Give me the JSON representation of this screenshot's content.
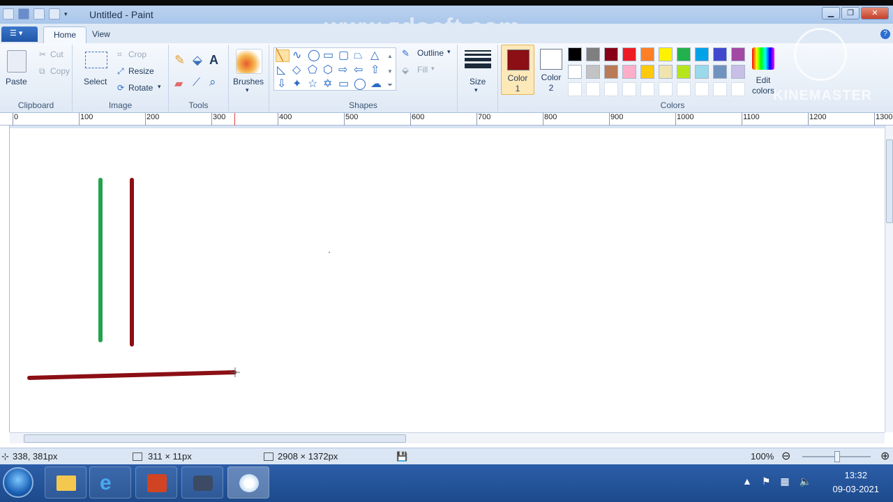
{
  "window": {
    "title": "Untitled - Paint",
    "watermark": "www.zdsoft.com",
    "kinemaster": "KINEMASTER"
  },
  "tabs": [
    {
      "label": "Home",
      "active": true
    },
    {
      "label": "View",
      "active": false
    }
  ],
  "clipboard": {
    "paste": "Paste",
    "cut": "Cut",
    "copy": "Copy",
    "group": "Clipboard"
  },
  "image": {
    "select": "Select",
    "crop": "Crop",
    "resize": "Resize",
    "rotate": "Rotate",
    "group": "Image"
  },
  "tools": {
    "group": "Tools"
  },
  "brushes": {
    "label": "Brushes"
  },
  "shapes": {
    "outline": "Outline",
    "fill": "Fill",
    "group": "Shapes"
  },
  "size": {
    "label": "Size"
  },
  "colors": {
    "color1_label": "Color",
    "color1_num": "1",
    "color2_label": "Color",
    "color2_num": "2",
    "color1_value": "#8b0f14",
    "color2_value": "#ffffff",
    "edit_colors": "Edit colors",
    "group": "Colors",
    "palette": [
      "#000000",
      "#7f7f7f",
      "#880015",
      "#ed1c24",
      "#ff7f27",
      "#fff200",
      "#22b14c",
      "#00a2e8",
      "#3f48cc",
      "#a349a4",
      "#ffffff",
      "#c3c3c3",
      "#b97a57",
      "#ffaec9",
      "#ffc90e",
      "#efe4b0",
      "#b5e61d",
      "#99d9ea",
      "#7092be",
      "#c8bfe7"
    ]
  },
  "ruler": {
    "ticks": [
      "0",
      "100",
      "200",
      "300",
      "400",
      "500",
      "600",
      "700",
      "800",
      "900",
      "1000",
      "1100",
      "1200",
      "1300"
    ]
  },
  "drawing": {
    "green_line_color": "#22a24c",
    "red_line_color": "#8b0f14"
  },
  "status": {
    "cursor": "338, 381px",
    "selection": "311 × 11px",
    "canvas_size": "2908 × 1372px",
    "zoom": "100%"
  },
  "taskbar": {
    "time": "13:32",
    "date": "09-03-2021"
  }
}
